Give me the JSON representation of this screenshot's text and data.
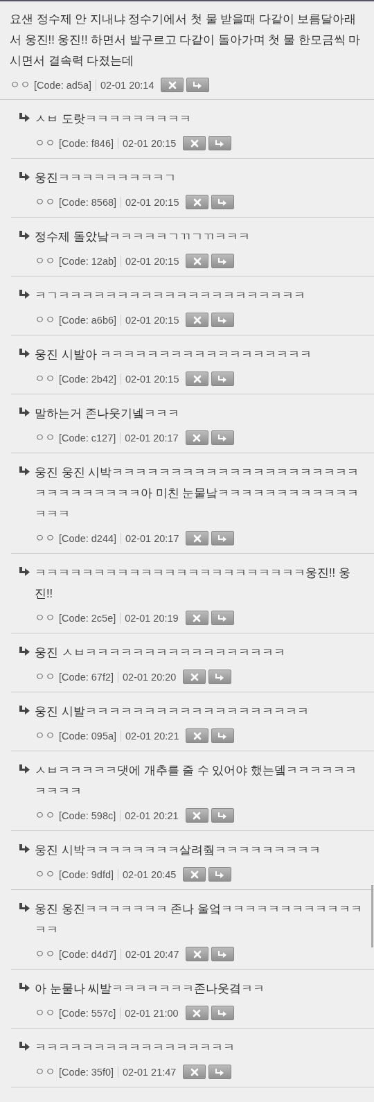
{
  "post": {
    "text": "요샌 정수제 안 지내냐 정수기에서 첫 물 받을때 다같이 보름달아래서 웅진!! 웅진!! 하면서 발구르고 다같이 돌아가며 첫 물 한모금씩 마시면서 결속력 다졌는데",
    "author": "ㅇㅇ",
    "code": "[Code: ad5a]",
    "time": "02-01 20:14"
  },
  "replies": [
    {
      "text": "ㅅㅂ 도랏ㅋㅋㅋㅋㅋㅋㅋㅋㅋ",
      "author": "ㅇㅇ",
      "code": "[Code: f846]",
      "time": "02-01 20:15"
    },
    {
      "text": "웅진ㅋㅋㅋㅋㅋㅋㅋㅋㅋㄱ",
      "author": "ㅇㅇ",
      "code": "[Code: 8568]",
      "time": "02-01 20:15"
    },
    {
      "text": "정수제 돌았낰ㅋㅋㅋㅋㅋㄱㄲㄱㄲㅋㅋㅋ",
      "author": "ㅇㅇ",
      "code": "[Code: 12ab]",
      "time": "02-01 20:15"
    },
    {
      "text": "ㅋㄱㅋㅋㅋㅋㅋㅋㅋㅋㅋㅋㅋㅋㅋㅋㅋㅋㅋㅋㅋㅋㅋ",
      "author": "ㅇㅇ",
      "code": "[Code: a6b6]",
      "time": "02-01 20:15"
    },
    {
      "text": "웅진 시발아 ㅋㅋㅋㅋㅋㅋㅋㅋㅋㅋㅋㅋㅋㅋㅋㅋㅋㅋ",
      "author": "ㅇㅇ",
      "code": "[Code: 2b42]",
      "time": "02-01 20:15"
    },
    {
      "text": "말하는거 존나웃기넼ㅋㅋㅋ",
      "author": "ㅇㅇ",
      "code": "[Code: c127]",
      "time": "02-01 20:17"
    },
    {
      "text": "웅진 웅진 시박ㅋㅋㅋㅋㅋㅋㅋㅋㅋㅋㅋㅋㅋㅋㅋㅋㅋㅋㅋㅋㅋㅋㅋㅋㅋㅋㅋㅋㅋㅋ아 미친 눈물낰ㅋㅋㅋㅋㅋㅋㅋㅋㅋㅋㅋㅋㅋㅋㅋ",
      "author": "ㅇㅇ",
      "code": "[Code: d244]",
      "time": "02-01 20:17"
    },
    {
      "text": "ㅋㅋㅋㅋㅋㅋㅋㅋㅋㅋㅋㅋㅋㅋㅋㅋㅋㅋㅋㅋㅋㅋㅋ웅진!! 웅진!!",
      "author": "ㅇㅇ",
      "code": "[Code: 2c5e]",
      "time": "02-01 20:19"
    },
    {
      "text": "웅진 ㅅㅂㅋㅋㅋㅋㅋㅋㅋㅋㅋㅋㅋㅋㅋㅋㅋㅋㅋ",
      "author": "ㅇㅇ",
      "code": "[Code: 67f2]",
      "time": "02-01 20:20"
    },
    {
      "text": "웅진 시발ㅋㅋㅋㅋㅋㅋㅋㅋㅋㅋㅋㅋㅋㅋㅋㅋㅋㅋㅋ",
      "author": "ㅇㅇ",
      "code": "[Code: 095a]",
      "time": "02-01 20:21"
    },
    {
      "text": "ㅅㅂㅋㅋㅋㅋㅋ댓에 개추를 줄 수 있어야 했는뎈ㅋㅋㅋㅋㅋㅋㅋㅋㅋㅋ",
      "author": "ㅇㅇ",
      "code": "[Code: 598c]",
      "time": "02-01 20:21"
    },
    {
      "text": "웅진 시박ㅋㅋㅋㅋㅋㅋㅋㅋ살려줰ㅋㅋㅋㅋㅋㅋㅋㅋㅋ",
      "author": "ㅇㅇ",
      "code": "[Code: 9dfd]",
      "time": "02-01 20:45"
    },
    {
      "text": "웅진 웅진ㅋㅋㅋㅋㅋㅋㅋ 존나 울엌ㅋㅋㅋㅋㅋㅋㅋㅋㅋㅋㅋㅋㅋㅋ",
      "author": "ㅇㅇ",
      "code": "[Code: d4d7]",
      "time": "02-01 20:47"
    },
    {
      "text": "아 눈물나 씨발ㅋㅋㅋㅋㅋㅋㅋ존나웃곀ㅋㅋ",
      "author": "ㅇㅇ",
      "code": "[Code: 557c]",
      "time": "02-01 21:00"
    },
    {
      "text": "ㅋㅋㅋㅋㅋㅋㅋㅋㅋㅋㅋㅋㅋㅋㅋㅋㅋ",
      "author": "ㅇㅇ",
      "code": "[Code: 35f0]",
      "time": "02-01 21:47"
    }
  ]
}
